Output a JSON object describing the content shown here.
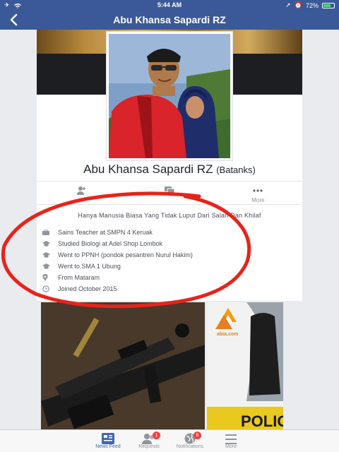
{
  "status_bar": {
    "time": "5:44 AM",
    "battery": "72%",
    "battery_level": 0.72
  },
  "nav": {
    "title": "Abu Khansa Sapardi RZ"
  },
  "profile": {
    "name": "Abu Khansa Sapardi RZ",
    "alternate_name": "(Batanks)"
  },
  "actions": [
    {
      "label": "",
      "icon": "add-friend-icon"
    },
    {
      "label": "",
      "icon": "message-icon"
    },
    {
      "label": "More",
      "icon": "more-dots-icon"
    }
  ],
  "bio": "Hanya Manusia Biasa Yang Tidak Luput Dari Salah Dan Khilaf",
  "info": [
    {
      "icon": "briefcase-icon",
      "text": "Sains Teacher at SMPN 4 Keruak"
    },
    {
      "icon": "graduation-cap-icon",
      "text": "Studied Biologi at Adel Shop Lombok"
    },
    {
      "icon": "graduation-cap-icon",
      "text": "Went to PPNH (pondok pesantren Nurul Hakim)"
    },
    {
      "icon": "graduation-cap-icon",
      "text": "Went to SMA 1 Ubung"
    },
    {
      "icon": "location-pin-icon",
      "text": "From Mataram"
    },
    {
      "icon": "clock-icon",
      "text": "Joined October 2015"
    }
  ],
  "photos": {
    "abia_logo_text": "abia.com",
    "poster_text": "POLIGA"
  },
  "tabs": [
    {
      "label": "News Feed",
      "icon": "news-feed-icon",
      "active": true,
      "badge": ""
    },
    {
      "label": "Requests",
      "icon": "friend-requests-icon",
      "active": false,
      "badge": "1"
    },
    {
      "label": "Notifications",
      "icon": "notifications-globe-icon",
      "active": false,
      "badge": "8"
    },
    {
      "label": "More",
      "icon": "hamburger-menu-icon",
      "active": false,
      "badge": ""
    }
  ],
  "colors": {
    "brand": "#3b5998",
    "annotation": "#e8231b",
    "badge": "#fa3e3e",
    "active_tab": "#4267b2"
  }
}
